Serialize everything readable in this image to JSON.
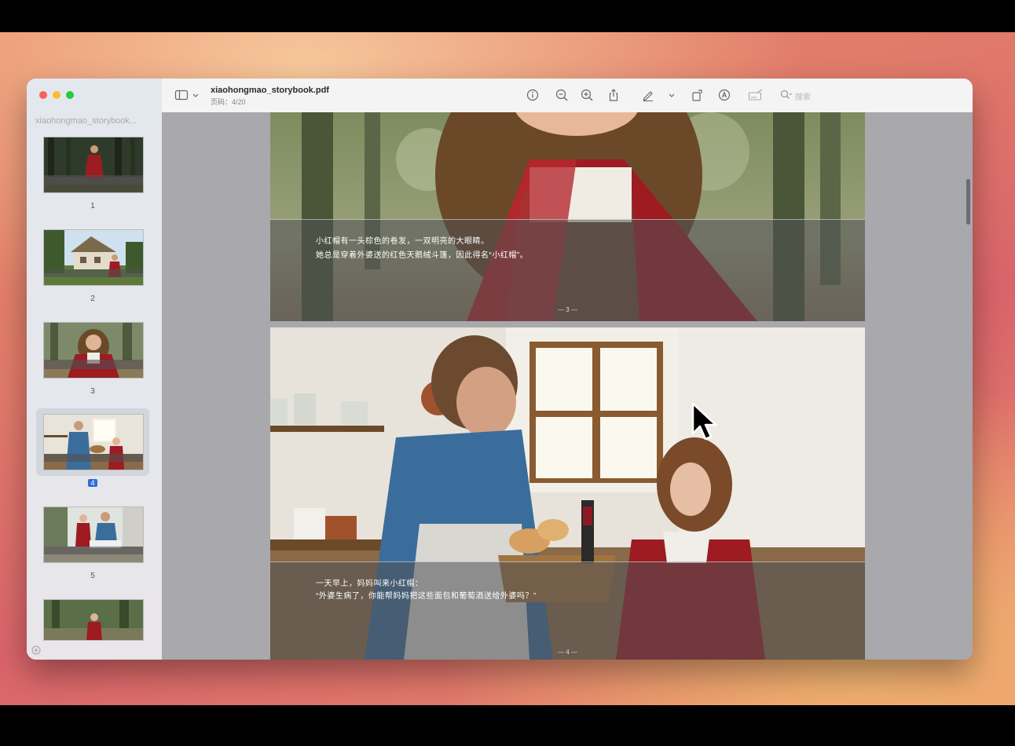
{
  "window": {
    "title": "xiaohongmao_storybook.pdf",
    "page_indicator": "页码：4/20"
  },
  "sidebar": {
    "title": "xiaohongmao_storybook...",
    "thumbnails": [
      {
        "label": "1",
        "selected": false
      },
      {
        "label": "2",
        "selected": false
      },
      {
        "label": "3",
        "selected": false
      },
      {
        "label": "4",
        "selected": true
      },
      {
        "label": "5",
        "selected": false
      },
      {
        "label": "",
        "selected": false
      }
    ]
  },
  "toolbar": {
    "icons": [
      "sidebar-toggle-icon",
      "chevron-down-icon",
      "info-icon",
      "zoom-out-icon",
      "zoom-in-icon",
      "share-icon",
      "highlight-pen-icon",
      "chevron-down-icon",
      "rotate-icon",
      "markup-icon",
      "signature-icon",
      "search-icon"
    ],
    "search_placeholder": "搜索"
  },
  "pages": [
    {
      "caption_lines": [
        "小红帽有一头棕色的卷发，一双明亮的大眼睛。",
        "她总是穿着外婆送的红色天鹅绒斗篷，因此得名“小红帽”。"
      ],
      "footer": "— 3 —"
    },
    {
      "caption_lines": [
        "一天早上，妈妈叫来小红帽：",
        "“外婆生病了，你能帮妈妈把这些面包和葡萄酒送给外婆吗？”"
      ],
      "footer": "— 4 —"
    }
  ],
  "colors": {
    "accent": "#2d6fd6",
    "cape_red": "#9e1b22"
  }
}
